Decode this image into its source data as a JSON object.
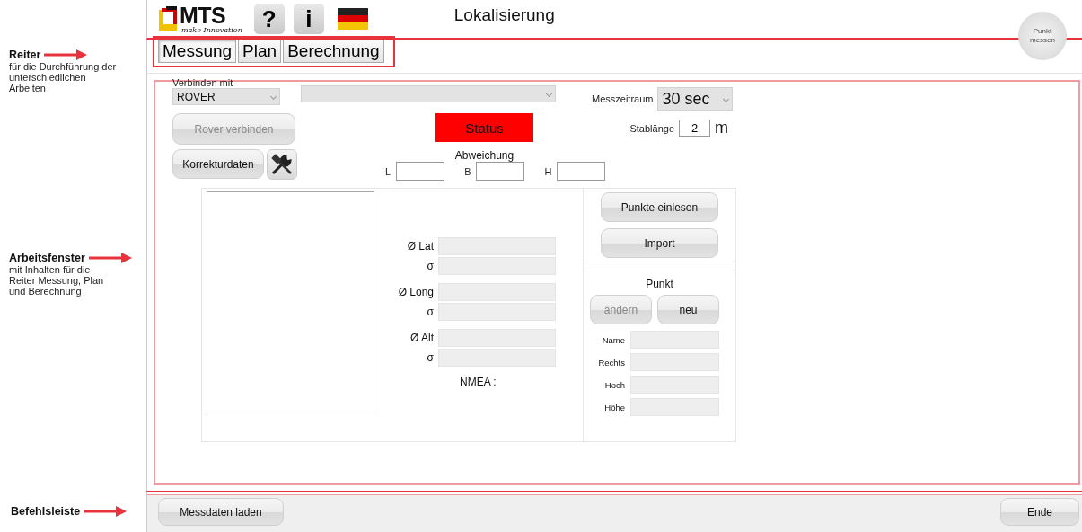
{
  "annotations": [
    {
      "title": "Reiter",
      "text": "für die Durchführung der unterschiedlichen Arbeiten"
    },
    {
      "title": "Arbeitsfenster",
      "text": "mit Inhalten für die Reiter Messung, Plan und Berechnung"
    },
    {
      "title": "Befehlsleiste"
    }
  ],
  "toolbar": {
    "logo": "MTS",
    "tagline": "make Innovation",
    "help": "?",
    "info": "i"
  },
  "window": {
    "title": "Lokalisierung"
  },
  "measure_button": "Punkt messen",
  "tabs": [
    {
      "label": "Messung",
      "selected": true
    },
    {
      "label": "Plan",
      "selected": false
    },
    {
      "label": "Berechnung",
      "selected": false
    }
  ],
  "connection": {
    "label": "Verbinden mit",
    "device": "ROVER"
  },
  "connect_button": {
    "label": "Rover verbinden",
    "disabled": true
  },
  "correction_button": {
    "label": "Korrekturdaten",
    "disabled": false
  },
  "status": "Status",
  "deviation": {
    "label": "Abweichung",
    "fields": [
      {
        "label": "L"
      },
      {
        "label": "B"
      },
      {
        "label": "H"
      }
    ]
  },
  "measurement_period": {
    "label": "Messzeitraum",
    "value": "30 sec"
  },
  "rod_length": {
    "label": "Stablänge",
    "value": "2",
    "unit": "m"
  },
  "statistics": [
    {
      "label": "Ø Lat",
      "sigma": "σ"
    },
    {
      "label": "Ø Long",
      "sigma": "σ"
    },
    {
      "label": "Ø Alt",
      "sigma": "σ"
    }
  ],
  "nmea": "NMEA :",
  "point_buttons": [
    {
      "label": "Punkte einlesen",
      "disabled": false
    },
    {
      "label": "Import",
      "disabled": false
    }
  ],
  "point": {
    "title": "Punkt",
    "buttons": [
      {
        "label": "ändern",
        "disabled": true
      },
      {
        "label": "neu",
        "disabled": false
      }
    ],
    "fields": [
      {
        "label": "Name"
      },
      {
        "label": "Rechts"
      },
      {
        "label": "Hoch"
      },
      {
        "label": "Höhe"
      }
    ]
  },
  "command_bar": [
    {
      "label": "Messdaten laden",
      "disabled": false
    },
    {
      "label": "Ende",
      "disabled": false
    }
  ]
}
